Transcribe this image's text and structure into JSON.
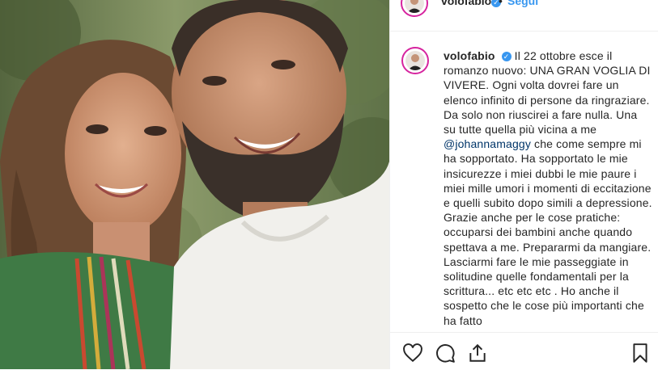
{
  "post": {
    "username": "volofabio",
    "follow_label": "Segui",
    "separator": "•",
    "caption_intro": "Il 22 ottobre esce il romanzo nuovo: UNA GRAN VOGLIA DI VIVERE. Ogni volta dovrei fare un elenco infinito di persone da ringraziare. Da solo non riuscirei a fare nulla. Una su tutte quella più vicina a me ",
    "mention": "@johannamaggy",
    "caption_rest": " che come sempre mi ha sopportato. Ha sopportato le mie insicurezze i miei dubbi le mie paure i miei mille umori i momenti di eccitazione e quelli subito dopo simili a depressione. Grazie anche per le cose pratiche: occuparsi dei bambini anche quando spettava a me. Prepararmi da mangiare. Lasciarmi fare le mie passeggiate in solitudine quelle fondamentali per la scrittura... etc etc etc . Ho anche il sospetto che le cose più importanti che ha fatto"
  },
  "icons": {
    "verified": "verified-badge-icon",
    "like": "heart-icon",
    "comment": "comment-icon",
    "share": "share-icon",
    "save": "bookmark-icon"
  },
  "colors": {
    "accent": "#3897f0",
    "mention": "#003569",
    "text": "#262626",
    "avatar_ring": "#d6249f"
  }
}
